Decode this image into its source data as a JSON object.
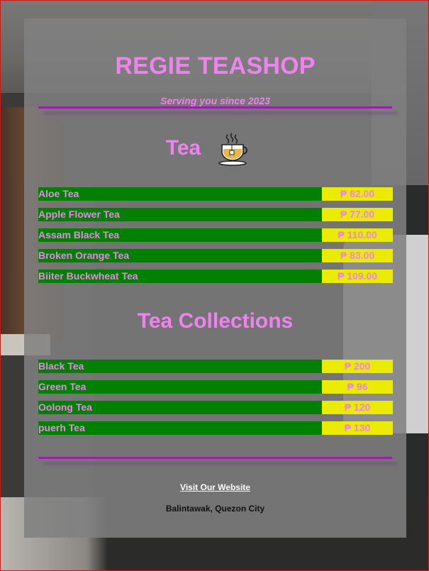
{
  "header": {
    "title": "REGIE TEASHOP",
    "subtitle": "Serving you since 2023"
  },
  "sections": [
    {
      "title": "Tea",
      "icon": "tea-cup-icon",
      "items": [
        {
          "name": "Aloe Tea",
          "price": "₱ 82.00"
        },
        {
          "name": "Apple Flower Tea",
          "price": "₱ 77.00"
        },
        {
          "name": "Assam Black Tea",
          "price": "₱ 110.00"
        },
        {
          "name": "Broken Orange Tea",
          "price": "₱ 83.00"
        },
        {
          "name": "Biiter Buckwheat Tea",
          "price": "₱ 109.00"
        }
      ]
    },
    {
      "title": "Tea Collections",
      "items": [
        {
          "name": "Black Tea",
          "price": "₱ 200"
        },
        {
          "name": "Green Tea",
          "price": "₱ 96"
        },
        {
          "name": "Oolong Tea",
          "price": "₱ 120"
        },
        {
          "name": "puerh Tea",
          "price": "₱ 130"
        }
      ]
    }
  ],
  "footer": {
    "link_label": "Visit Our Website",
    "address": "Balintawak, Quezon City"
  },
  "colors": {
    "accent_text": "#ee82ee",
    "name_bg": "#028002",
    "price_bg": "#ebeb00",
    "divider": "#9b1fa8"
  }
}
